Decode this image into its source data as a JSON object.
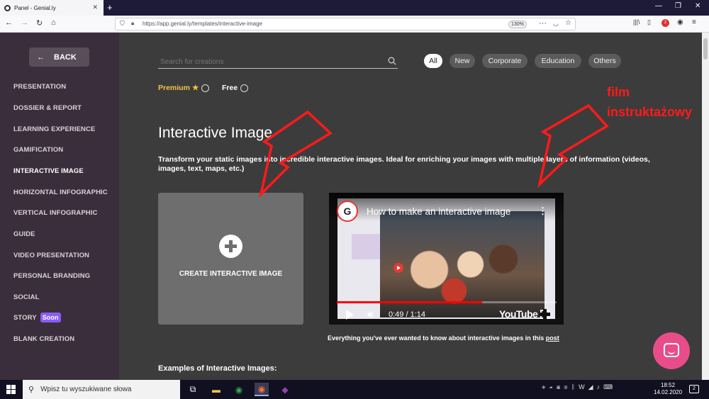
{
  "browser": {
    "tab_title": "Panel - Genial.ly",
    "url": "https://app.genial.ly/templates/interactive-image",
    "zoom": "130%",
    "badge_count": "2"
  },
  "sidebar": {
    "back_label": "BACK",
    "items": [
      {
        "label": "PRESENTATION"
      },
      {
        "label": "DOSSIER & REPORT"
      },
      {
        "label": "LEARNING EXPERIENCE"
      },
      {
        "label": "GAMIFICATION"
      },
      {
        "label": "INTERACTIVE IMAGE",
        "active": true
      },
      {
        "label": "HORIZONTAL INFOGRAPHIC"
      },
      {
        "label": "VERTICAL INFOGRAPHIC"
      },
      {
        "label": "GUIDE"
      },
      {
        "label": "VIDEO PRESENTATION"
      },
      {
        "label": "PERSONAL BRANDING"
      },
      {
        "label": "SOCIAL"
      },
      {
        "label": "STORY",
        "badge": "Soon"
      },
      {
        "label": "BLANK CREATION"
      }
    ]
  },
  "search": {
    "placeholder": "Search for creations"
  },
  "filters": [
    {
      "label": "All",
      "active": true
    },
    {
      "label": "New"
    },
    {
      "label": "Corporate"
    },
    {
      "label": "Education"
    },
    {
      "label": "Others"
    }
  ],
  "plan_filters": {
    "premium": "Premium",
    "free": "Free"
  },
  "main": {
    "title": "Interactive Image",
    "description": "Transform your static images into incredible interactive images. Ideal for enriching your images with multiple layers of information (videos, images, text, maps, etc.)",
    "create_label": "CREATE INTERACTIVE IMAGE",
    "examples_heading": "Examples of Interactive Images:"
  },
  "video": {
    "title": "How to make an interactive image",
    "logo_letter": "G",
    "time": "0:49 / 1:14",
    "brand": "YouTube",
    "progress": 0.66,
    "caption": "Everything you've ever wanted to know about interactive images in this",
    "caption_link": "post"
  },
  "annotation": {
    "line1": "film",
    "line2": "instruktażowy",
    "color": "#ff1a1a"
  },
  "taskbar": {
    "search_placeholder": "Wpisz tu wyszukiwane słowa",
    "time": "18:52",
    "date": "14.02.2020",
    "notifications": "2"
  }
}
